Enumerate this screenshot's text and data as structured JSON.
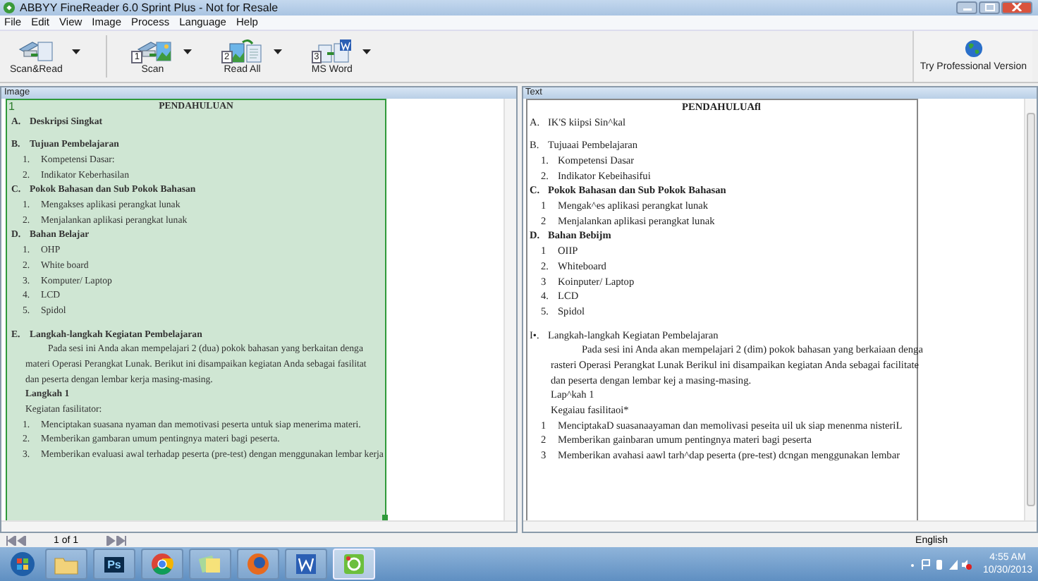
{
  "window": {
    "title": "ABBYY FineReader 6.0 Sprint Plus - Not for Resale"
  },
  "menu": [
    "File",
    "Edit",
    "View",
    "Image",
    "Process",
    "Language",
    "Help"
  ],
  "toolbar": [
    {
      "label": "Scan&Read",
      "kind": "scanread"
    },
    {
      "label": "Scan",
      "step": "1",
      "kind": "scan"
    },
    {
      "label": "Read All",
      "step": "2",
      "kind": "read"
    },
    {
      "label": "MS Word",
      "step": "3",
      "kind": "word"
    }
  ],
  "try_pro": {
    "label": "Try Professional Version"
  },
  "image_pane": {
    "title": "Image",
    "block_number": "1",
    "lines": [
      {
        "kind": "title",
        "text": "PENDAHULUAN"
      },
      {
        "kind": "heading",
        "marker": "A.",
        "text": "Deskripsi Singkat"
      },
      {
        "kind": "heading",
        "marker": "B.",
        "text": "Tujuan Pembelajaran",
        "gap_before": true
      },
      {
        "kind": "item",
        "marker": "1.",
        "text": "Kompetensi Dasar:"
      },
      {
        "kind": "item",
        "marker": "2.",
        "text": "Indikator Keberhasilan"
      },
      {
        "kind": "heading",
        "marker": "C.",
        "text": "Pokok Bahasan dan Sub Pokok Bahasan"
      },
      {
        "kind": "item",
        "marker": "1.",
        "text": "Mengakses aplikasi perangkat lunak"
      },
      {
        "kind": "item",
        "marker": "2.",
        "text": "Menjalankan aplikasi perangkat lunak"
      },
      {
        "kind": "heading",
        "marker": "D.",
        "text": "Bahan Belajar"
      },
      {
        "kind": "item",
        "marker": "1.",
        "text": "OHP"
      },
      {
        "kind": "item",
        "marker": "2.",
        "text": "White board"
      },
      {
        "kind": "item",
        "marker": "3.",
        "text": "Komputer/ Laptop"
      },
      {
        "kind": "item",
        "marker": "4.",
        "text": "LCD"
      },
      {
        "kind": "item",
        "marker": "5.",
        "text": "Spidol"
      },
      {
        "kind": "heading",
        "marker": "E.",
        "text": "Langkah-langkah Kegiatan Pembelajaran",
        "gap_before": true
      },
      {
        "kind": "para",
        "text": "Pada sesi ini Anda akan mempelajari 2 (dua) pokok bahasan yang berkaitan denga",
        "indent": true
      },
      {
        "kind": "para",
        "text": "materi Operasi Perangkat Lunak. Berikut ini disampaikan kegiatan Anda sebagai fasilitat"
      },
      {
        "kind": "para",
        "text": "dan peserta dengan lembar kerja masing-masing."
      },
      {
        "kind": "para",
        "text": "Langkah 1",
        "bold": true
      },
      {
        "kind": "plain",
        "text": "Kegiatan fasilitator:"
      },
      {
        "kind": "item",
        "marker": "1.",
        "text": "Menciptakan suasana nyaman dan memotivasi peserta untuk siap menerima materi."
      },
      {
        "kind": "item",
        "marker": "2.",
        "text": "Memberikan gambaran umum pentingnya materi bagi peserta."
      },
      {
        "kind": "item",
        "marker": "3.",
        "text": "Memberikan evaluasi awal terhadap peserta (pre-test) dengan menggunakan lembar kerja"
      }
    ]
  },
  "text_pane": {
    "title": "Text",
    "lines": [
      {
        "kind": "title",
        "text": "PENDAHULUAfl"
      },
      {
        "kind": "plain",
        "marker": "A.",
        "text": "IK'S kiipsi Sin^kal"
      },
      {
        "kind": "plain",
        "marker": "B.",
        "text": "Tujuaai Pembelajaran",
        "gap_before": true
      },
      {
        "kind": "item",
        "marker": "1.",
        "text": "Kompetensi Dasar"
      },
      {
        "kind": "item",
        "marker": "2.",
        "text": "Indikator Kebeihasifui"
      },
      {
        "kind": "heading",
        "marker": "C.",
        "text": "Pokok Bahasan dan Sub Pokok Bahasan"
      },
      {
        "kind": "item",
        "marker": "1",
        "text": "Mengak^es aplikasi perangkat lunak"
      },
      {
        "kind": "item",
        "marker": "2",
        "text": "Menjalankan aplikasi perangkat lunak"
      },
      {
        "kind": "heading",
        "marker": "D.",
        "text": "**Bahan** Bebijm"
      },
      {
        "kind": "item",
        "marker": "1",
        "text": "OIIP"
      },
      {
        "kind": "item",
        "marker": "2.",
        "text": "Whiteboard"
      },
      {
        "kind": "item",
        "marker": "3",
        "text": "Koinputer/ Laptop"
      },
      {
        "kind": "item",
        "marker": "4.",
        "text": "LCD"
      },
      {
        "kind": "item",
        "marker": "5.",
        "text": "Spidol"
      },
      {
        "kind": "plain",
        "marker": "I•.",
        "text": "Langkah-langkah Kegiatan Pembelajaran",
        "gap_before": true
      },
      {
        "kind": "para",
        "text": "Pada sesi ini Anda akan mempelajari 2 (dim) pokok bahasan yang berkaiaan denga",
        "indent": true
      },
      {
        "kind": "para",
        "text": "rasteri Operasi Perangkat Lunak Berikul ini disampaikan kegiatan Anda sebagai facilitate"
      },
      {
        "kind": "para",
        "text": "dan peserta dengan lembar kej a masing-masing."
      },
      {
        "kind": "para",
        "text": "Lap^kah 1"
      },
      {
        "kind": "para",
        "text": "Kegaiau fasilitaoi*"
      },
      {
        "kind": "item",
        "marker": "1",
        "text": "MenciptakaD suasanaayaman dan memolivasi peseita uil uk siap menenma nisteriL"
      },
      {
        "kind": "item",
        "marker": "2",
        "text": "Memberikan gainbaran umum pentingnya materi bagi peserta"
      },
      {
        "kind": "item",
        "marker": "3",
        "text": "Memberikan avahasi aawl tarh^dap peserta (pre-test) dcngan menggunakan lembar"
      }
    ]
  },
  "page_nav": {
    "label": "1 of 1"
  },
  "status_bar": {
    "language": "English"
  },
  "taskbar": {
    "apps": [
      {
        "kind": "folder",
        "selected": false
      },
      {
        "kind": "ps",
        "label": "Ps",
        "selected": false
      },
      {
        "kind": "chrome",
        "selected": false
      },
      {
        "kind": "notes",
        "selected": false
      },
      {
        "kind": "firefox",
        "selected": false
      },
      {
        "kind": "word",
        "selected": false
      },
      {
        "kind": "finereader",
        "selected": true
      }
    ],
    "time": "4:55 AM",
    "date": "10/30/2013"
  }
}
